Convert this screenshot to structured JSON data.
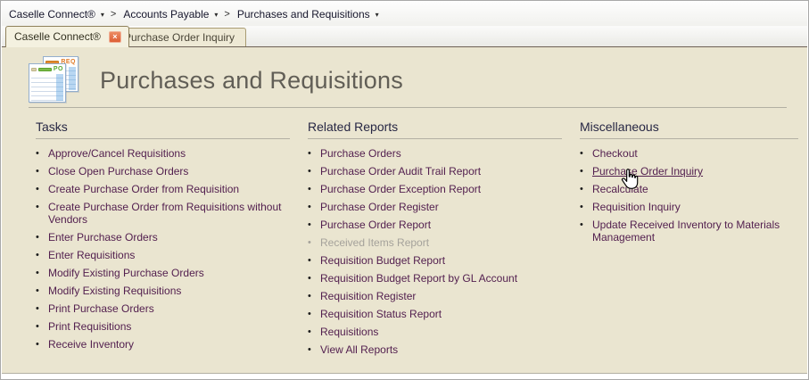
{
  "breadcrumb": {
    "separator": ">",
    "dropdown_arrow": "▾",
    "items": [
      {
        "label": "Caselle Connect®"
      },
      {
        "label": "Accounts Payable"
      },
      {
        "label": "Purchases and Requisitions"
      }
    ]
  },
  "tabs": [
    {
      "label": "Caselle Connect®",
      "active": true,
      "close_label": "×"
    },
    {
      "label": "Purchase Order Inquiry",
      "active": false
    }
  ],
  "page": {
    "title": "Purchases and Requisitions",
    "icon": {
      "back_label": "REQ",
      "front_label": "PO"
    }
  },
  "sections": [
    {
      "title": "Tasks",
      "items": [
        {
          "label": "Approve/Cancel Requisitions",
          "state": "normal"
        },
        {
          "label": "Close Open Purchase Orders",
          "state": "normal"
        },
        {
          "label": "Create Purchase Order from Requisition",
          "state": "normal"
        },
        {
          "label": "Create Purchase Order from Requisitions without Vendors",
          "state": "normal"
        },
        {
          "label": "Enter Purchase Orders",
          "state": "normal"
        },
        {
          "label": "Enter Requisitions",
          "state": "normal"
        },
        {
          "label": "Modify Existing Purchase Orders",
          "state": "normal"
        },
        {
          "label": "Modify Existing Requisitions",
          "state": "normal"
        },
        {
          "label": "Print Purchase Orders",
          "state": "normal"
        },
        {
          "label": "Print Requisitions",
          "state": "normal"
        },
        {
          "label": "Receive Inventory",
          "state": "normal"
        }
      ]
    },
    {
      "title": "Related Reports",
      "items": [
        {
          "label": "Purchase Orders",
          "state": "normal"
        },
        {
          "label": "Purchase Order Audit Trail Report",
          "state": "normal"
        },
        {
          "label": "Purchase Order Exception Report",
          "state": "normal"
        },
        {
          "label": "Purchase Order Register",
          "state": "normal"
        },
        {
          "label": "Purchase Order Report",
          "state": "normal"
        },
        {
          "label": "Received Items Report",
          "state": "disabled"
        },
        {
          "label": "Requisition Budget Report",
          "state": "normal"
        },
        {
          "label": "Requisition Budget Report by GL Account",
          "state": "normal"
        },
        {
          "label": "Requisition Register",
          "state": "normal"
        },
        {
          "label": "Requisition Status Report",
          "state": "normal"
        },
        {
          "label": "Requisitions",
          "state": "normal"
        },
        {
          "label": "View All Reports",
          "state": "normal"
        }
      ]
    },
    {
      "title": "Miscellaneous",
      "items": [
        {
          "label": "Checkout",
          "state": "normal"
        },
        {
          "label": "Purchase Order Inquiry",
          "state": "hovered"
        },
        {
          "label": "Recalculate",
          "state": "normal"
        },
        {
          "label": "Requisition Inquiry",
          "state": "normal"
        },
        {
          "label": "Update Received Inventory to Materials Management",
          "state": "normal"
        }
      ]
    }
  ],
  "colors": {
    "content_background": "#eae5d0",
    "link": "#53204f",
    "disabled_link": "#a5a29b",
    "section_title": "#272744",
    "page_title": "#615e56",
    "tab_fill": "#f4f1e0",
    "tab_border": "#8f815b",
    "strip_bottom_border": "#6e6156",
    "close_button": "#dd5f35",
    "icon_req_accent": "#e07b28",
    "icon_po_accent": "#57a832"
  }
}
